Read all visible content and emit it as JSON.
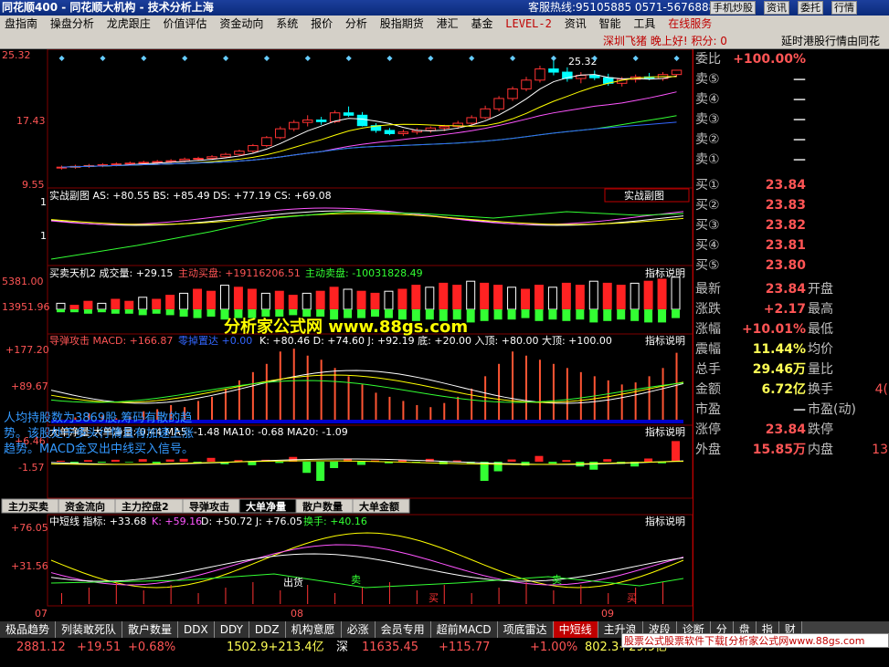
{
  "title": "同花顺400 - 同花顺大机构 - 技术分析上海",
  "hotline": "客服热线:95105885 0571-56768888",
  "title_buttons": [
    "手机炒股",
    "资讯",
    "委托",
    "行情"
  ],
  "menu": [
    "盘指南",
    "操盘分析",
    "龙虎跟庄",
    "价值评估",
    "资金动向",
    "系统",
    "报价",
    "分析",
    "股指期货",
    "港汇",
    "基金",
    "LEVEL-2",
    "资讯",
    "智能",
    "工具",
    "在线服务"
  ],
  "infobar": {
    "user": "深圳飞猪  晚上好!  积分: 0",
    "notice": "延时港股行情由同花"
  },
  "watermark": "分析家公式网 www.88gs.com",
  "panels": {
    "main": {
      "ticks": [
        "25.32",
        "17.43",
        "9.55"
      ],
      "peak": "25.32"
    },
    "p1": {
      "legend": "实战副图 AS: +80.55 BS: +85.49 DS: +77.19 CS: +69.08",
      "button": "实战副图",
      "ticks": [
        "1",
        "1"
      ]
    },
    "p2": {
      "legend_a": "买卖天机2 成交量: +29.15",
      "legend_b": "主动买盘: +19116206.51",
      "legend_c": "主动卖盘: -10031828.49",
      "help": "指标说明",
      "ticks": [
        "5381.00",
        "13951.96"
      ]
    },
    "p3": {
      "legend_a": "导弹攻击 MACD: +166.87",
      "legend_b": "零掉置达 +0.00",
      "legend_c": "K: +80.46 D: +74.60 J: +92.19 底: +20.00 入顶: +80.00 大顶: +100.00",
      "help": "指标说明",
      "ticks": [
        "+177.20",
        "+89.67"
      ]
    },
    "p4": {
      "legend": "大单净量 大单净量: 0.44 MA5: -1.48 MA10: -0.68 MA20: -1.09",
      "help": "指标说明",
      "ticks": [
        "+6.46",
        "-1.57"
      ]
    },
    "tabs": [
      "主力买卖",
      "资金流向",
      "主力控盘2",
      "导弹攻击",
      "大单净量",
      "散户数量",
      "大单金额"
    ],
    "active_tab": "大单净量",
    "p5": {
      "legend_a": "中短线 指标: +33.68",
      "legend_b": "K: +59.16",
      "legend_c": "D: +50.72 J: +76.05",
      "legend_d": "换手: +40.16",
      "help": "指标说明",
      "ticks": [
        "+76.05",
        "+31.56"
      ],
      "labels": [
        "出货",
        "卖",
        "卖",
        "买",
        "买"
      ]
    },
    "dates": [
      "07",
      "08",
      "09"
    ]
  },
  "quote": [
    {
      "l": "委比",
      "v": "+100.00%"
    },
    {
      "l": "卖⑤",
      "v": "—"
    },
    {
      "l": "卖④",
      "v": "—"
    },
    {
      "l": "卖③",
      "v": "—"
    },
    {
      "l": "卖②",
      "v": "—"
    },
    {
      "l": "卖①",
      "v": "—"
    },
    {
      "l": "买①",
      "v": "23.84"
    },
    {
      "l": "买②",
      "v": "23.83"
    },
    {
      "l": "买③",
      "v": "23.82"
    },
    {
      "l": "买④",
      "v": "23.81"
    },
    {
      "l": "买⑤",
      "v": "23.80"
    },
    {
      "l": "最新",
      "v": "23.84",
      "l2": "开盘"
    },
    {
      "l": "涨跌",
      "v": "+2.17",
      "l2": "最高"
    },
    {
      "l": "涨幅",
      "v": "+10.01%",
      "l2": "最低"
    },
    {
      "l": "震幅",
      "v": "11.44%",
      "l2": "均价"
    },
    {
      "l": "总手",
      "v": "29.46万",
      "l2": "量比"
    },
    {
      "l": "金额",
      "v": "6.72亿",
      "l2": "换手",
      "v3": "4("
    },
    {
      "l": "市盈",
      "v": "—",
      "l2": "市盈(动)"
    },
    {
      "l": "涨停",
      "v": "23.84",
      "l2": "跌停"
    },
    {
      "l": "外盘",
      "v": "15.85万",
      "l2": "内盘",
      "v3": "13"
    }
  ],
  "summary": "人均持股数为3869股,筹码有散的趋势。该股处于多头行情且有加速上涨趋势。MACD金叉出中线买入信号。",
  "bottom_tabs": [
    "极品趋势",
    "列装敢死队",
    "散户数量",
    "DDX",
    "DDY",
    "DDZ",
    "机构意愿",
    "必涨",
    "会员专用",
    "超前MACD",
    "项底雷达",
    "中短线",
    "主升浪",
    "波段",
    "诊断",
    "分",
    "盘",
    "指",
    "财"
  ],
  "status": [
    {
      "t": "2881.12",
      "c": "#ff5555"
    },
    {
      "t": "+19.51",
      "c": "#ff5555"
    },
    {
      "t": "+0.68%",
      "c": "#ff5555"
    },
    {
      "t": "1502.9+213.4亿",
      "c": "#ffff55"
    },
    {
      "t": "深",
      "c": "#fff"
    },
    {
      "t": "11635.45",
      "c": "#ff5555"
    },
    {
      "t": "+115.77",
      "c": "#ff5555"
    },
    {
      "t": "+1.00%",
      "c": "#ff5555"
    },
    {
      "t": "802.3+29.9亿",
      "c": "#ffff55"
    }
  ],
  "ad": "股票公式股票软件下载[分析家公式网www.88gs.com",
  "chart_data": [
    {
      "type": "candlestick",
      "title": "",
      "ylim": [
        9.55,
        25.32
      ],
      "yticks": [
        25.32,
        17.43,
        9.55
      ],
      "annotation_high": 25.32,
      "ohlc": [
        [
          11.6,
          11.9,
          11.4,
          11.7
        ],
        [
          11.7,
          12.0,
          11.5,
          11.8
        ],
        [
          11.8,
          12.1,
          11.6,
          11.9
        ],
        [
          11.9,
          12.2,
          11.7,
          12.0
        ],
        [
          12.0,
          12.3,
          11.8,
          12.1
        ],
        [
          12.1,
          12.4,
          11.9,
          12.2
        ],
        [
          12.2,
          12.5,
          12.0,
          12.3
        ],
        [
          12.3,
          12.6,
          12.1,
          12.4
        ],
        [
          12.4,
          12.7,
          12.2,
          12.5
        ],
        [
          12.5,
          12.9,
          12.3,
          12.7
        ],
        [
          12.7,
          13.0,
          12.5,
          12.8
        ],
        [
          12.8,
          13.2,
          12.6,
          13.0
        ],
        [
          13.0,
          13.5,
          12.8,
          13.3
        ],
        [
          13.3,
          13.9,
          13.1,
          13.7
        ],
        [
          13.7,
          14.6,
          13.5,
          14.4
        ],
        [
          14.4,
          15.6,
          14.2,
          15.4
        ],
        [
          15.4,
          16.8,
          15.2,
          16.5
        ],
        [
          16.5,
          17.6,
          16.2,
          17.3
        ],
        [
          17.3,
          18.2,
          16.8,
          17.6
        ],
        [
          17.6,
          18.0,
          17.0,
          17.4
        ],
        [
          17.4,
          18.8,
          17.2,
          18.5
        ],
        [
          18.5,
          19.3,
          18.0,
          18.2
        ],
        [
          18.2,
          18.6,
          16.8,
          16.9
        ],
        [
          16.9,
          17.2,
          16.0,
          16.3
        ],
        [
          16.3,
          16.6,
          15.7,
          15.9
        ],
        [
          15.9,
          16.4,
          15.6,
          16.1
        ],
        [
          16.1,
          16.6,
          15.8,
          16.3
        ],
        [
          16.3,
          16.8,
          16.0,
          16.6
        ],
        [
          16.6,
          17.0,
          16.2,
          16.8
        ],
        [
          16.8,
          17.5,
          16.5,
          17.2
        ],
        [
          17.2,
          18.2,
          17.0,
          17.9
        ],
        [
          17.9,
          19.4,
          17.7,
          19.0
        ],
        [
          19.0,
          20.6,
          18.7,
          20.3
        ],
        [
          20.3,
          21.8,
          20.0,
          21.5
        ],
        [
          21.5,
          23.0,
          21.2,
          22.6
        ],
        [
          22.6,
          24.4,
          22.3,
          24.0
        ],
        [
          24.0,
          25.32,
          23.2,
          23.6
        ],
        [
          23.6,
          24.2,
          22.4,
          22.8
        ],
        [
          22.8,
          23.6,
          22.2,
          23.2
        ],
        [
          23.2,
          23.8,
          22.6,
          22.9
        ],
        [
          22.9,
          23.4,
          21.9,
          22.2
        ],
        [
          22.2,
          23.0,
          21.8,
          22.7
        ],
        [
          22.7,
          23.3,
          22.3,
          23.0
        ],
        [
          23.0,
          23.5,
          22.6,
          22.8
        ],
        [
          22.8,
          23.6,
          22.5,
          23.3
        ],
        [
          23.3,
          23.84,
          23.0,
          23.84
        ]
      ]
    },
    {
      "type": "line",
      "title": "实战副图",
      "series": [
        {
          "name": "AS",
          "values": [
            80.55
          ]
        },
        {
          "name": "BS",
          "values": [
            85.49
          ]
        },
        {
          "name": "DS",
          "values": [
            77.19
          ]
        },
        {
          "name": "CS",
          "values": [
            69.08
          ]
        }
      ]
    },
    {
      "type": "bar",
      "title": "买卖天机2",
      "yticks": [
        5381.0,
        13951.96
      ],
      "series": [
        {
          "name": "成交量",
          "values": [
            29.15
          ]
        },
        {
          "name": "主动买盘",
          "values": [
            19116206.51
          ]
        },
        {
          "name": "主动卖盘",
          "values": [
            -10031828.49
          ]
        }
      ],
      "buy": [
        3,
        2,
        4,
        3,
        5,
        4,
        6,
        5,
        7,
        8,
        10,
        9,
        12,
        11,
        10,
        8,
        9,
        7,
        8,
        9,
        11,
        10,
        9,
        8,
        9,
        10,
        12,
        11,
        13,
        12,
        14,
        13,
        12,
        11,
        10,
        12,
        11,
        13,
        12,
        14,
        13,
        12,
        13,
        14,
        15,
        16
      ],
      "sell": [
        -2,
        -2,
        -3,
        -2,
        -3,
        -3,
        -4,
        -3,
        -4,
        -5,
        -6,
        -5,
        -7,
        -6,
        -6,
        -5,
        -5,
        -4,
        -5,
        -5,
        -7,
        -6,
        -6,
        -5,
        -6,
        -7,
        -8,
        -7,
        -8,
        -7,
        -9,
        -8,
        -7,
        -7,
        -6,
        -8,
        -7,
        -8,
        -7,
        -9,
        -8,
        -7,
        -8,
        -9,
        -9,
        -6
      ]
    },
    {
      "type": "line",
      "title": "导弹攻击",
      "yticks": [
        177.2,
        89.67
      ],
      "series": [
        {
          "name": "MACD",
          "values": [
            166.87
          ]
        },
        {
          "name": "K",
          "values": [
            80.46
          ]
        },
        {
          "name": "D",
          "values": [
            74.6
          ]
        },
        {
          "name": "J",
          "values": [
            92.19
          ]
        }
      ],
      "macd": [
        5,
        10,
        20,
        15,
        8,
        12,
        25,
        30,
        40,
        35,
        50,
        60,
        80,
        100,
        120,
        140,
        170,
        177,
        160,
        150,
        130,
        110,
        90,
        70,
        60,
        50,
        40,
        35,
        45,
        60,
        80,
        110,
        140,
        170,
        160,
        150,
        140,
        130,
        120,
        110,
        100,
        90,
        95,
        110,
        130,
        166.87
      ]
    },
    {
      "type": "bar",
      "title": "大单净量",
      "yticks": [
        6.46,
        -1.57
      ],
      "series": [
        {
          "name": "大单净量",
          "values": [
            0.44
          ]
        },
        {
          "name": "MA5",
          "values": [
            -1.48
          ]
        },
        {
          "name": "MA10",
          "values": [
            -0.68
          ]
        },
        {
          "name": "MA20",
          "values": [
            -1.09
          ]
        }
      ],
      "values": [
        0.3,
        -0.4,
        0.5,
        -0.3,
        0.6,
        -0.2,
        0.8,
        -0.5,
        0.7,
        0.9,
        -0.6,
        1.2,
        -0.8,
        0.5,
        -1.1,
        0.6,
        -0.4,
        1.5,
        -3.5,
        -6.0,
        -2.0,
        0.8,
        -1.0,
        0.4,
        -0.5,
        0.6,
        -0.3,
        0.9,
        -0.8,
        0.4,
        -0.5,
        -6.0,
        -3.0,
        0.7,
        -1.2,
        1.8,
        -0.6,
        0.5,
        -1.5,
        -2.5,
        0.8,
        -0.7,
        -1.5,
        1.0,
        -0.5,
        6.46
      ]
    },
    {
      "type": "line",
      "title": "中短线",
      "yticks": [
        76.05,
        31.56
      ],
      "series": [
        {
          "name": "指标",
          "values": [
            33.68
          ]
        },
        {
          "name": "K",
          "values": [
            59.16
          ]
        },
        {
          "name": "D",
          "values": [
            50.72
          ]
        },
        {
          "name": "J",
          "values": [
            76.05
          ]
        },
        {
          "name": "换手",
          "values": [
            40.16
          ]
        }
      ]
    }
  ]
}
